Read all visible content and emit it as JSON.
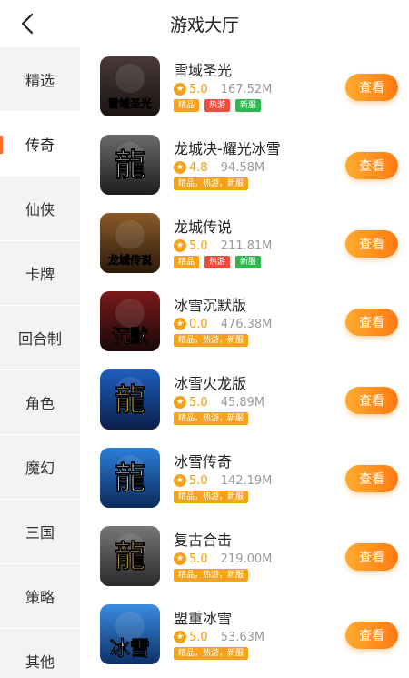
{
  "header": {
    "title": "游戏大厅"
  },
  "sidebar": {
    "items": [
      {
        "label": "精选"
      },
      {
        "label": "传奇"
      },
      {
        "label": "仙侠"
      },
      {
        "label": "卡牌"
      },
      {
        "label": "回合制"
      },
      {
        "label": "角色"
      },
      {
        "label": "魔幻"
      },
      {
        "label": "三国"
      },
      {
        "label": "策略"
      },
      {
        "label": "其他"
      }
    ],
    "active_index": 1
  },
  "games": [
    {
      "name": "雪域圣光",
      "rating": "5.0",
      "size": "167.52M",
      "tags": [
        "精品",
        "热游",
        "新服"
      ],
      "tag_colors": [
        "#f5a21c",
        "#f04b3c",
        "#2db84d"
      ],
      "button": "查看",
      "icon": "game-icon-snow-holy-light",
      "icon_text": "雪域圣光"
    },
    {
      "name": "龙城决-耀光冰雪",
      "rating": "4.8",
      "size": "94.58M",
      "tags": [
        "精品，热游，新服"
      ],
      "tag_colors": [
        "#f5a21c"
      ],
      "button": "查看",
      "icon": "game-icon-dragon-city",
      "icon_text": "龍"
    },
    {
      "name": "龙城传说",
      "rating": "5.0",
      "size": "211.81M",
      "tags": [
        "精品",
        "热游",
        "新服"
      ],
      "tag_colors": [
        "#f5a21c",
        "#f04b3c",
        "#2db84d"
      ],
      "button": "查看",
      "icon": "game-icon-dragon-legend",
      "icon_text": "龙城传说"
    },
    {
      "name": "冰雪沉默版",
      "rating": "0.0",
      "size": "476.38M",
      "tags": [
        "精品，热游，新服"
      ],
      "tag_colors": [
        "#f5a21c"
      ],
      "button": "查看",
      "icon": "game-icon-ice-silent",
      "icon_text": "沉默"
    },
    {
      "name": "冰雪火龙版",
      "rating": "5.0",
      "size": "45.89M",
      "tags": [
        "精品，热游，新服"
      ],
      "tag_colors": [
        "#f5a21c"
      ],
      "button": "查看",
      "icon": "game-icon-ice-fire-dragon",
      "icon_text": "龍"
    },
    {
      "name": "冰雪传奇",
      "rating": "5.0",
      "size": "142.19M",
      "tags": [
        "精品，热游，新服"
      ],
      "tag_colors": [
        "#f5a21c"
      ],
      "button": "查看",
      "icon": "game-icon-ice-legend",
      "icon_text": "龍"
    },
    {
      "name": "复古合击",
      "rating": "5.0",
      "size": "219.00M",
      "tags": [
        "精品，热游，新服"
      ],
      "tag_colors": [
        "#f5a21c"
      ],
      "button": "查看",
      "icon": "game-icon-retro-combo",
      "icon_text": "龍"
    },
    {
      "name": "盟重冰雪",
      "rating": "5.0",
      "size": "53.63M",
      "tags": [
        "精品，热游，新服"
      ],
      "tag_colors": [
        "#f5a21c"
      ],
      "button": "查看",
      "icon": "game-icon-mengzhong-ice",
      "icon_text": "冰雪"
    }
  ]
}
